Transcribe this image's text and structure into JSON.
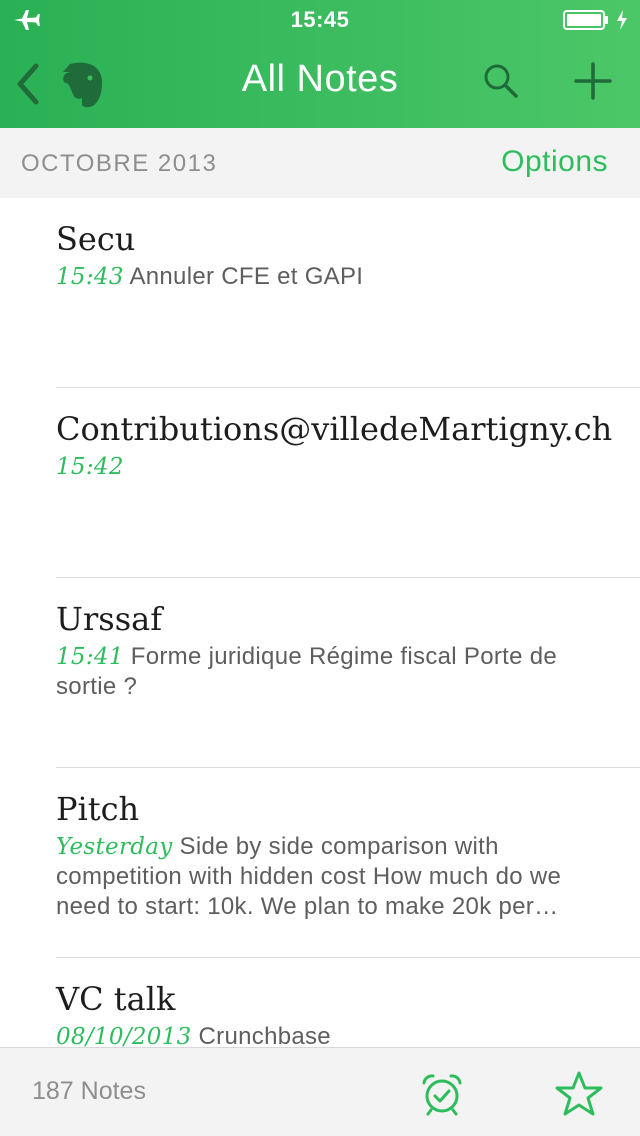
{
  "status_bar": {
    "time": "15:45"
  },
  "nav": {
    "title": "All Notes"
  },
  "section": {
    "date": "OCTOBRE 2013",
    "options_label": "Options"
  },
  "notes": [
    {
      "title": "Secu",
      "stamp": "15:43",
      "snippet": "Annuler CFE et GAPI"
    },
    {
      "title": "Contributions@villedeMartigny.ch",
      "stamp": "15:42",
      "snippet": ""
    },
    {
      "title": "Urssaf",
      "stamp": "15:41",
      "snippet": "Forme juridique Régime fiscal Porte de sortie ?"
    },
    {
      "title": "Pitch",
      "stamp": "Yesterday",
      "snippet": "Side by side comparison with competition with hidden cost How much do we need to start: 10k. We plan to make 20k per month..."
    },
    {
      "title": "VC talk",
      "stamp": "08/10/2013",
      "snippet": "Crunchbase"
    }
  ],
  "footer": {
    "count_label": "187 Notes"
  },
  "colors": {
    "brand_green": "#2dbd5c",
    "header_green": "#3dbb5e",
    "dark_green": "#1f6b3a"
  },
  "icons": [
    "airplane-icon",
    "battery-icon",
    "charging-bolt-icon",
    "back-chevron-icon",
    "evernote-elephant-icon",
    "search-icon",
    "plus-icon",
    "reminder-alarm-icon",
    "star-icon"
  ]
}
